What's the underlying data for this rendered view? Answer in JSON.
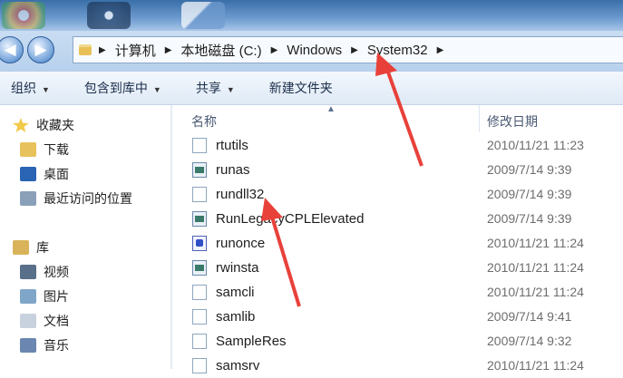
{
  "breadcrumb": [
    "计算机",
    "本地磁盘 (C:)",
    "Windows",
    "System32"
  ],
  "toolbar": {
    "organize": "组织",
    "include_library": "包含到库中",
    "share": "共享",
    "new_folder": "新建文件夹"
  },
  "sidebar": {
    "favorites": "收藏夹",
    "downloads": "下载",
    "desktop": "桌面",
    "recent": "最近访问的位置",
    "libraries": "库",
    "videos": "视频",
    "pictures": "图片",
    "documents": "文档",
    "music": "音乐"
  },
  "columns": {
    "name": "名称",
    "date": "修改日期"
  },
  "files": [
    {
      "name": "rtutils",
      "date": "2010/11/21 11:23",
      "icon": "doc-icon"
    },
    {
      "name": "runas",
      "date": "2009/7/14 9:39",
      "icon": "exe-icon"
    },
    {
      "name": "rundll32",
      "date": "2009/7/14 9:39",
      "icon": "doc-icon"
    },
    {
      "name": "RunLegacyCPLElevated",
      "date": "2009/7/14 9:39",
      "icon": "exe-icon"
    },
    {
      "name": "runonce",
      "date": "2010/11/21 11:24",
      "icon": "run-icon"
    },
    {
      "name": "rwinsta",
      "date": "2010/11/21 11:24",
      "icon": "exe-icon"
    },
    {
      "name": "samcli",
      "date": "2010/11/21 11:24",
      "icon": "doc-icon"
    },
    {
      "name": "samlib",
      "date": "2009/7/14 9:41",
      "icon": "doc-icon"
    },
    {
      "name": "SampleRes",
      "date": "2009/7/14 9:32",
      "icon": "doc-icon"
    },
    {
      "name": "samsrv",
      "date": "2010/11/21 11:24",
      "icon": "doc-icon"
    }
  ],
  "colors": {
    "annotation_arrow": "#e8413a",
    "toolbar_text": "#1b2d4a"
  }
}
